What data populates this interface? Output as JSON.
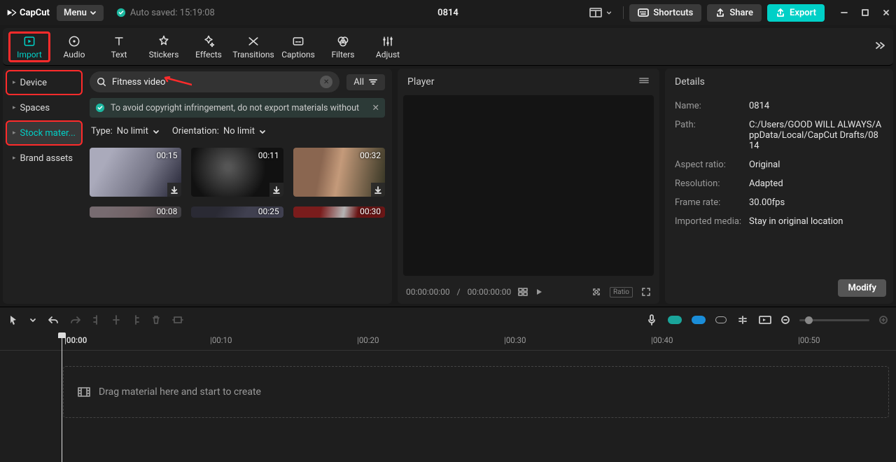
{
  "app": {
    "name": "CapCut",
    "autosave": "Auto saved: 15:19:08",
    "project": "0814"
  },
  "titlebar": {
    "menu": "Menu",
    "shortcuts": "Shortcuts",
    "share": "Share",
    "export": "Export"
  },
  "tooltabs": [
    {
      "id": "import",
      "label": "Import"
    },
    {
      "id": "audio",
      "label": "Audio"
    },
    {
      "id": "text",
      "label": "Text"
    },
    {
      "id": "stickers",
      "label": "Stickers"
    },
    {
      "id": "effects",
      "label": "Effects"
    },
    {
      "id": "transitions",
      "label": "Transitions"
    },
    {
      "id": "captions",
      "label": "Captions"
    },
    {
      "id": "filters",
      "label": "Filters"
    },
    {
      "id": "adjust",
      "label": "Adjust"
    }
  ],
  "sidenav": {
    "device": "Device",
    "spaces": "Spaces",
    "stock": "Stock mater...",
    "brand": "Brand assets"
  },
  "search": {
    "query": "Fitness video",
    "all": "All"
  },
  "infobar": "To avoid copyright infringement, do not export materials without",
  "filters": {
    "type_label": "Type:",
    "type_value": "No limit",
    "orient_label": "Orientation:",
    "orient_value": "No limit"
  },
  "clips": [
    {
      "dur": "00:15"
    },
    {
      "dur": "00:11"
    },
    {
      "dur": "00:32"
    },
    {
      "dur": "00:08"
    },
    {
      "dur": "00:25"
    },
    {
      "dur": "00:30"
    }
  ],
  "player": {
    "title": "Player",
    "time_cur": "00:00:00:00",
    "time_total": "00:00:00:00",
    "ratio": "Ratio"
  },
  "details": {
    "title": "Details",
    "rows": {
      "name_k": "Name:",
      "name_v": "0814",
      "path_k": "Path:",
      "path_v": "C:/Users/GOOD WILL ALWAYS/AppData/Local/CapCut Drafts/0814",
      "aspect_k": "Aspect ratio:",
      "aspect_v": "Original",
      "res_k": "Resolution:",
      "res_v": "Adapted",
      "fps_k": "Frame rate:",
      "fps_v": "30.00fps",
      "imp_k": "Imported media:",
      "imp_v": "Stay in original location"
    },
    "modify": "Modify"
  },
  "timeline": {
    "ticks": [
      "00:00",
      "00:10",
      "00:20",
      "00:30",
      "00:40",
      "00:50"
    ],
    "drop": "Drag material here and start to create"
  }
}
